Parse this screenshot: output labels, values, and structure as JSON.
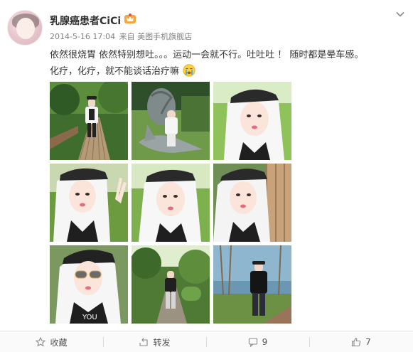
{
  "post": {
    "username": "乳腺癌患者CiCi",
    "timestamp": "2014-5-16 17:04",
    "source_prefix": "来自",
    "source": "美图手机旗舰店",
    "text_line1": "依然很烧胃 依然特别想吐。。。运动一会就不行。吐吐吐 ！ 随时都是晕车感。",
    "text_line2": "化疗，化疗，就不能谈话治疗嘛"
  },
  "photos": [
    {
      "name": "photo-1",
      "scene": "boardwalk-garden"
    },
    {
      "name": "photo-2",
      "scene": "snail-sculpture"
    },
    {
      "name": "photo-3",
      "scene": "selfie-cap-hood"
    },
    {
      "name": "photo-4",
      "scene": "selfie-peace-sign"
    },
    {
      "name": "photo-5",
      "scene": "selfie-cap-hood"
    },
    {
      "name": "photo-6",
      "scene": "selfie-fence"
    },
    {
      "name": "photo-7",
      "scene": "selfie-sunglasses"
    },
    {
      "name": "photo-8",
      "scene": "tree-path"
    },
    {
      "name": "photo-9",
      "scene": "sea-view"
    }
  ],
  "actions": {
    "favorite_label": "收藏",
    "repost_label": "转发",
    "comment_count": "9",
    "like_count": "7"
  },
  "icons": {
    "vip": "vip-crown-icon",
    "menu": "chevron-down-icon",
    "favorite": "star-icon",
    "repost": "repost-icon",
    "comment": "comment-icon",
    "like": "thumbs-up-icon",
    "emoji": "crying-face-icon"
  },
  "colors": {
    "accent_orange": "#f28c28",
    "text_gray": "#808080",
    "divider": "#e6e6e6"
  }
}
